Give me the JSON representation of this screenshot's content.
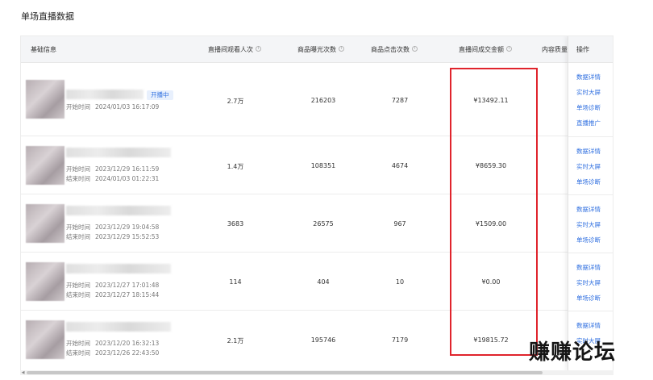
{
  "page": {
    "title": "单场直播数据"
  },
  "table": {
    "headers": {
      "basic_info": "基础信息",
      "viewers": "直播间观看人次",
      "exposures": "商品曝光次数",
      "clicks": "商品点击次数",
      "gmv": "直播间成交金额",
      "quality": "内容质量",
      "ops": "操作"
    },
    "rows": [
      {
        "status": "开播中",
        "start_label": "开始时间",
        "start": "2024/01/03 16:17:09",
        "end_label": "",
        "end": "",
        "viewers": "2.7万",
        "exposures": "216203",
        "clicks": "7287",
        "gmv": "¥13492.11",
        "ops": [
          "数据详情",
          "实时大屏",
          "单场诊断",
          "直播推广"
        ]
      },
      {
        "status": "",
        "start_label": "开始时间",
        "start": "2023/12/29 16:11:59",
        "end_label": "结束时间",
        "end": "2024/01/03 01:22:31",
        "viewers": "1.4万",
        "exposures": "108351",
        "clicks": "4674",
        "gmv": "¥8659.30",
        "ops": [
          "数据详情",
          "实时大屏",
          "单场诊断"
        ]
      },
      {
        "status": "",
        "start_label": "开始时间",
        "start": "2023/12/29 19:04:58",
        "end_label": "结束时间",
        "end": "2023/12/29 15:52:53",
        "viewers": "3683",
        "exposures": "26575",
        "clicks": "967",
        "gmv": "¥1509.00",
        "ops": [
          "数据详情",
          "实时大屏",
          "单场诊断"
        ]
      },
      {
        "status": "",
        "start_label": "开始时间",
        "start": "2023/12/27 17:01:48",
        "end_label": "结束时间",
        "end": "2023/12/27 18:15:44",
        "viewers": "114",
        "exposures": "404",
        "clicks": "10",
        "gmv": "¥0.00",
        "ops": [
          "数据详情",
          "实时大屏",
          "单场诊断"
        ]
      },
      {
        "status": "",
        "start_label": "开始时间",
        "start": "2023/12/20 16:32:13",
        "end_label": "结束时间",
        "end": "2023/12/26 22:43:50",
        "viewers": "2.1万",
        "exposures": "195746",
        "clicks": "7179",
        "gmv": "¥19815.72",
        "ops": [
          "数据详情",
          "实时大屏"
        ]
      }
    ]
  },
  "watermark": "赚赚论坛",
  "colors": {
    "link": "#2f6fe0",
    "highlight": "#e0242c",
    "header_bg": "#f4f5f7"
  }
}
